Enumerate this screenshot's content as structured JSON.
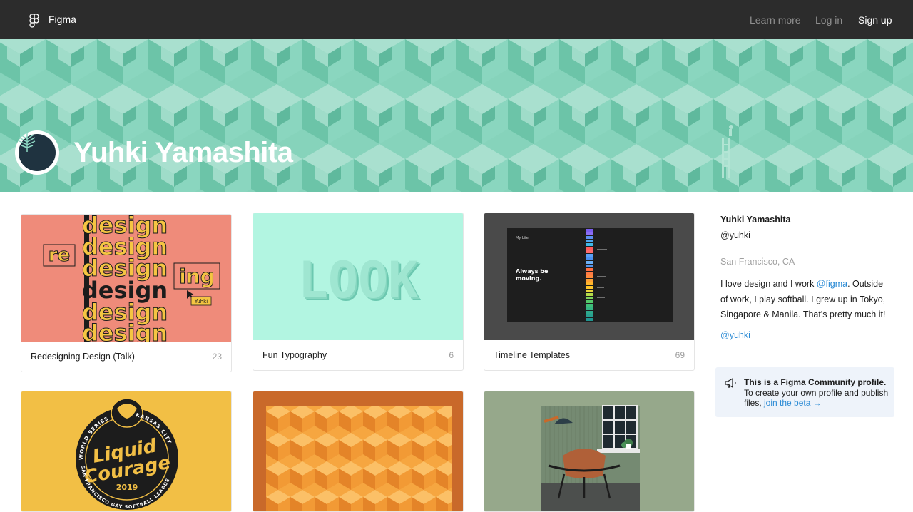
{
  "nav": {
    "brand": "Figma",
    "learn_more": "Learn more",
    "log_in": "Log in",
    "sign_up": "Sign up"
  },
  "profile": {
    "name": "Yuhki Yamashita"
  },
  "cards": [
    {
      "title": "Redesigning Design (Talk)",
      "count": "23"
    },
    {
      "title": "Fun Typography",
      "count": "6"
    },
    {
      "title": "Timeline Templates",
      "count": "69"
    },
    {
      "title": "",
      "count": ""
    },
    {
      "title": "",
      "count": ""
    },
    {
      "title": "",
      "count": ""
    }
  ],
  "thumbs": {
    "redesign": {
      "word": "design",
      "re": "re",
      "ing": "ing",
      "tag": "Yuhki"
    },
    "typography": {
      "word": "LOOK"
    },
    "timeline": {
      "heading": "My Life",
      "tagline_1": "Always be",
      "tagline_2": "moving."
    },
    "badge": {
      "line1": "Liquid",
      "line2": "Courage",
      "year": "2019",
      "top_text": "WORLD SERIES",
      "right_text": "KANSAS CITY",
      "bottom_text": "SAN FRANCISCO GAY SOFTBALL LEAGUE"
    }
  },
  "sidebar": {
    "name": "Yuhki Yamashita",
    "handle": "@yuhki",
    "location": "San Francisco, CA",
    "bio_1": "I love design and I work ",
    "bio_link": "@figma",
    "bio_2": ". Outside of work, I play softball. I grew up in Tokyo, Singapore & Manila. That's pretty much it!",
    "link": "@yuhki",
    "notice_bold": "This is a Figma Community profile.",
    "notice_text": "To create your own profile and publish files, ",
    "notice_link": "join the beta →"
  },
  "colors": {
    "navbar": "#2c2c2c",
    "banner": "#7dd0b6",
    "link": "#2a8ad4",
    "notice_bg": "#eef3fa"
  }
}
